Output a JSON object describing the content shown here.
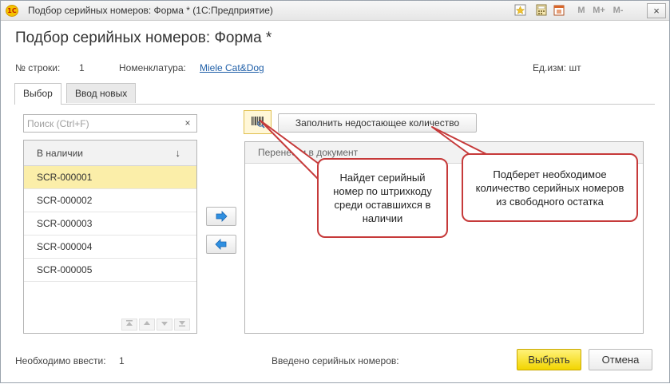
{
  "window": {
    "title": "Подбор серийных номеров: Форма * (1С:Предприятие)",
    "logo_text": "1С",
    "toolbar_buttons": [
      "M",
      "M+",
      "M-"
    ],
    "close_glyph": "×"
  },
  "form": {
    "title": "Подбор серийных номеров: Форма *"
  },
  "info": {
    "row_label": "№ строки:",
    "row_value": "1",
    "nomenclature_label": "Номенклатура:",
    "nomenclature_value": "Miele Cat&Dog",
    "unit_label": "Ед.изм: шт"
  },
  "tabs": [
    {
      "label": "Выбор",
      "active": true
    },
    {
      "label": "Ввод новых",
      "active": false
    }
  ],
  "search": {
    "placeholder": "Поиск (Ctrl+F)",
    "value": "",
    "clear_glyph": "×"
  },
  "available_list": {
    "header": "В наличии",
    "sort_glyph": "↓",
    "items": [
      "SCR-000001",
      "SCR-000002",
      "SCR-000003",
      "SCR-000004",
      "SCR-000005"
    ],
    "selected_index": 0
  },
  "toolbar": {
    "fill_button_label": "Заполнить недостающее количество"
  },
  "document_table": {
    "header": "Перенести в документ"
  },
  "callouts": {
    "barcode": "Найдет серийный номер по штрихкоду среди оставшихся в наличии",
    "fill": "Подберет необходимое количество серийных номеров из свободного остатка"
  },
  "footer": {
    "required_label": "Необходимо ввести:",
    "required_value": "1",
    "entered_label": "Введено серийных номеров:",
    "select_button": "Выбрать",
    "cancel_button": "Отмена"
  },
  "colors": {
    "accent_yellow": "#f2d500",
    "selection": "#fbeea9",
    "link": "#1f5fa8",
    "callout_border": "#c63a3a"
  }
}
